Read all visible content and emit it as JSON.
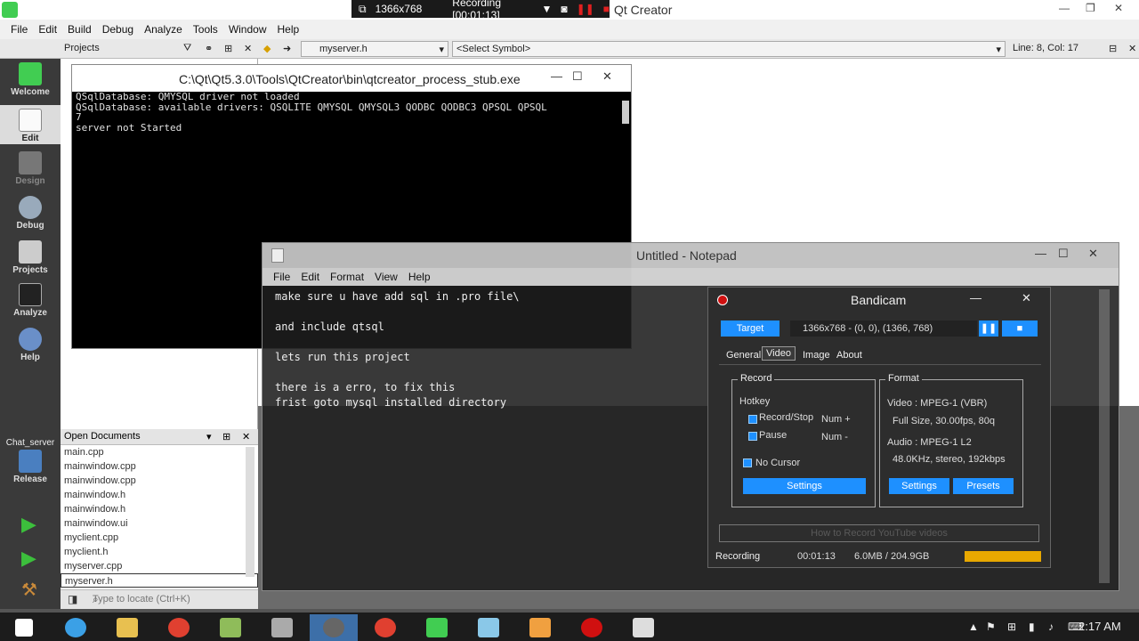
{
  "qt": {
    "window_title": "Qt Creator",
    "menu": [
      "File",
      "Edit",
      "Build",
      "Debug",
      "Analyze",
      "Tools",
      "Window",
      "Help"
    ],
    "toolbar": {
      "projects_label": "Projects",
      "file_combo": "myserver.h",
      "symbol_combo": "<Select Symbol>",
      "position": "Line: 8, Col: 17"
    },
    "modes": [
      "Welcome",
      "Edit",
      "Design",
      "Debug",
      "Projects",
      "Analyze",
      "Help"
    ],
    "kit": {
      "project": "Chat_server",
      "build": "Release"
    },
    "open_documents": {
      "header": "Open Documents",
      "files": [
        "main.cpp",
        "mainwindow.cpp",
        "mainwindow.cpp",
        "mainwindow.h",
        "mainwindow.h",
        "mainwindow.ui",
        "myclient.cpp",
        "myclient.h",
        "myserver.cpp",
        "myserver.h"
      ]
    },
    "locator_placeholder": "Type to locate (Ctrl+K)"
  },
  "recording_bar": {
    "resolution": "1366x768",
    "status": "Recording [00:01:13]"
  },
  "console": {
    "title": "C:\\Qt\\Qt5.3.0\\Tools\\QtCreator\\bin\\qtcreator_process_stub.exe",
    "lines": [
      "QSqlDatabase: QMYSQL driver not loaded",
      "QSqlDatabase: available drivers: QSQLITE QMYSQL QMYSQL3 QODBC QODBC3 QPSQL QPSQL",
      "7",
      "server not Started"
    ]
  },
  "notepad": {
    "title": "Untitled - Notepad",
    "menu": [
      "File",
      "Edit",
      "Format",
      "View",
      "Help"
    ],
    "lines": [
      "make sure u have add sql in .pro file\\",
      "",
      "and include qtsql",
      "",
      "lets run this project",
      "",
      "there is a erro, to fix this",
      "frist goto mysql installed directory"
    ]
  },
  "bandicam": {
    "title": "Bandicam",
    "target_button": "Target",
    "target_info": "1366x768 - (0, 0), (1366, 768)",
    "tabs": [
      "General",
      "Video",
      "Image",
      "About"
    ],
    "record_group": "Record",
    "hotkey_label": "Hotkey",
    "record_stop": {
      "label": "Record/Stop",
      "key": "Num +"
    },
    "pause": {
      "label": "Pause",
      "key": "Num -"
    },
    "no_cursor": "No Cursor",
    "settings_button": "Settings",
    "format_group": "Format",
    "video_format": "Video : MPEG-1 (VBR)",
    "video_detail": "Full Size, 30.00fps, 80q",
    "audio_format": "Audio : MPEG-1 L2",
    "audio_detail": "48.0KHz, stereo, 192kbps",
    "format_settings_button": "Settings",
    "presets_button": "Presets",
    "link": "How to Record YouTube videos",
    "status_label": "Recording",
    "elapsed": "00:01:13",
    "size": "6.0MB / 204.9GB"
  },
  "taskbar": {
    "clock": "2:17 AM"
  }
}
